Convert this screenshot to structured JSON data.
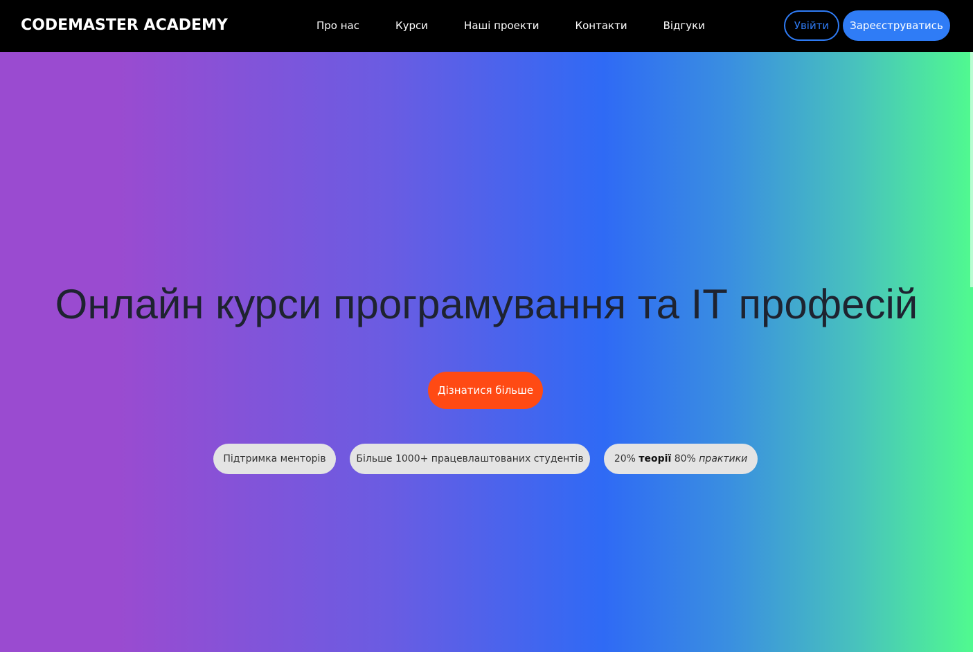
{
  "navbar": {
    "logo": "CODEMASTER ACADEMY",
    "links": [
      {
        "label": "Про нас"
      },
      {
        "label": "Курси"
      },
      {
        "label": "Наші проекти"
      },
      {
        "label": "Контакти"
      },
      {
        "label": "Відгуки"
      }
    ],
    "login_label": "Увійти",
    "register_label": "Зареєструватись"
  },
  "hero": {
    "title": "Онлайн курси програмування та IT професій",
    "cta_label": "Дізнатися більше",
    "features": [
      {
        "label": "Підтримка менторів"
      },
      {
        "label": "Більше 1000+ працевлаштованих студентів"
      },
      {
        "prefix": "20% ",
        "bold": "теорії",
        "middle": " 80% ",
        "italic": "практики"
      }
    ]
  },
  "colors": {
    "navbar_bg": "#000000",
    "accent_blue": "#2f7cf6",
    "cta_orange": "#ff4a14",
    "pill_bg": "#e4e4e4",
    "gradient_start": "#9a4bd0",
    "gradient_mid": "#2f6af5",
    "gradient_end": "#50fa8f"
  }
}
